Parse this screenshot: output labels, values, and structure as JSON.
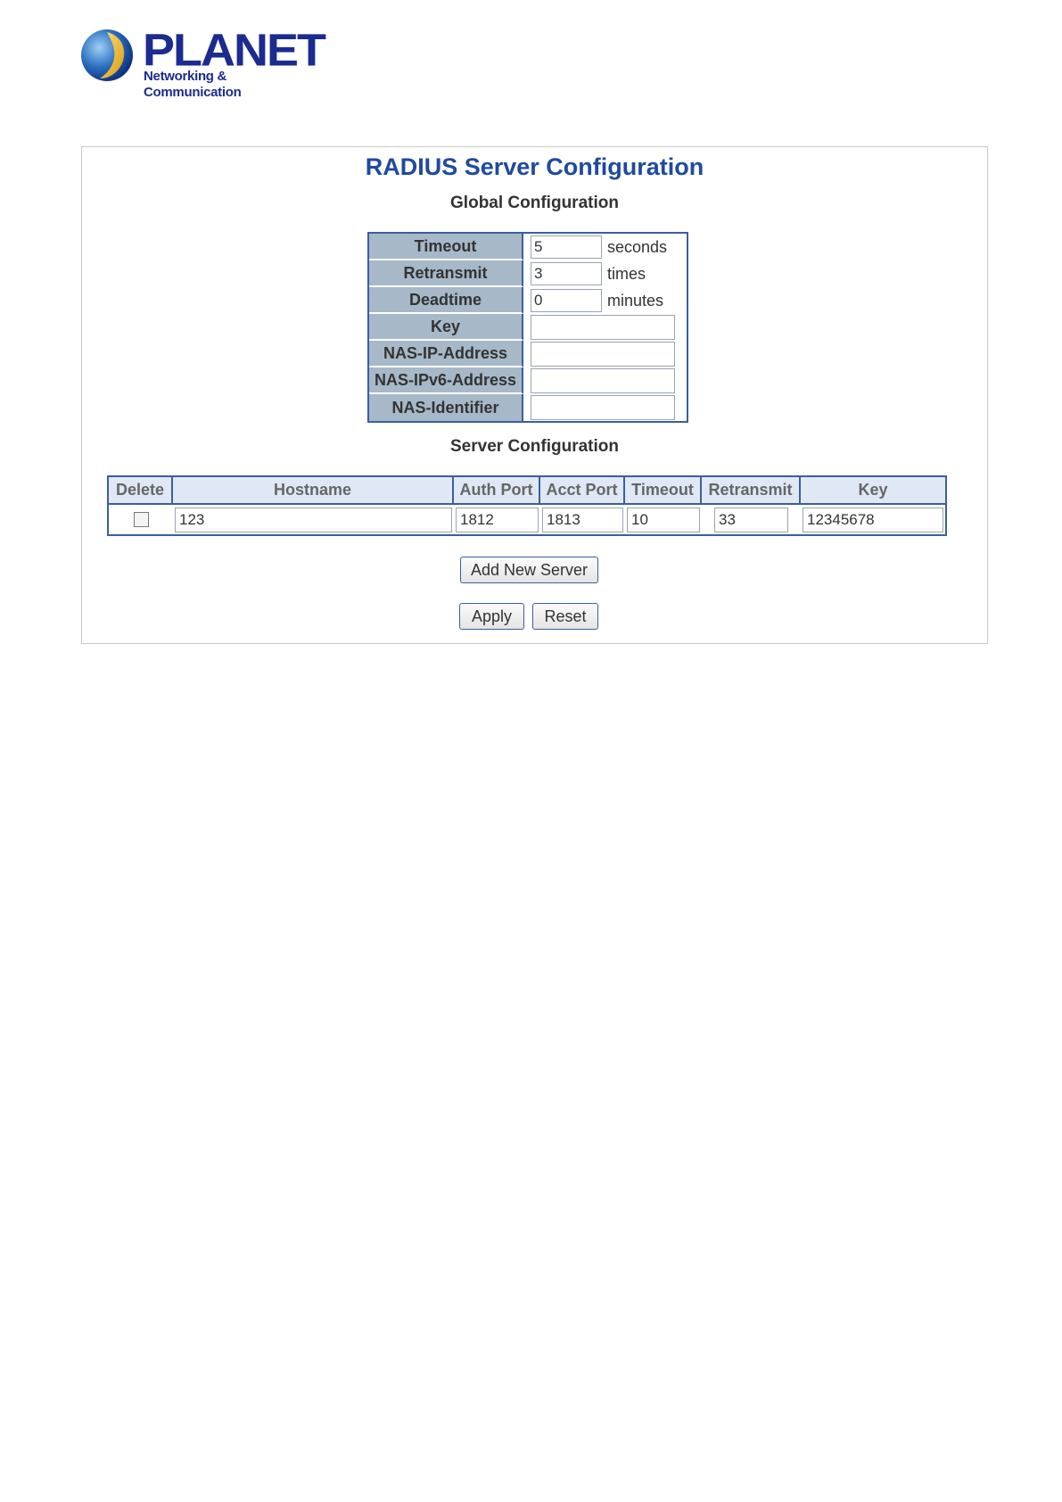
{
  "logo": {
    "brand": "PLANET",
    "tagline": "Networking & Communication"
  },
  "page": {
    "title": "RADIUS Server Configuration",
    "global_title": "Global Configuration",
    "server_title": "Server Configuration"
  },
  "global": {
    "timeout": {
      "label": "Timeout",
      "value": "5",
      "unit": "seconds"
    },
    "retransmit": {
      "label": "Retransmit",
      "value": "3",
      "unit": "times"
    },
    "deadtime": {
      "label": "Deadtime",
      "value": "0",
      "unit": "minutes"
    },
    "key": {
      "label": "Key",
      "value": ""
    },
    "nas_ip": {
      "label": "NAS-IP-Address",
      "value": ""
    },
    "nas_ipv6": {
      "label": "NAS-IPv6-Address",
      "value": ""
    },
    "nas_id": {
      "label": "NAS-Identifier",
      "value": ""
    }
  },
  "servers": {
    "columns": [
      "Delete",
      "Hostname",
      "Auth Port",
      "Acct Port",
      "Timeout",
      "Retransmit",
      "Key"
    ],
    "rows": [
      {
        "hostname": "123",
        "auth_port": "1812",
        "acct_port": "1813",
        "timeout": "10",
        "retransmit": "33",
        "key": "12345678"
      }
    ]
  },
  "buttons": {
    "add_server": "Add New Server",
    "apply": "Apply",
    "reset": "Reset"
  }
}
